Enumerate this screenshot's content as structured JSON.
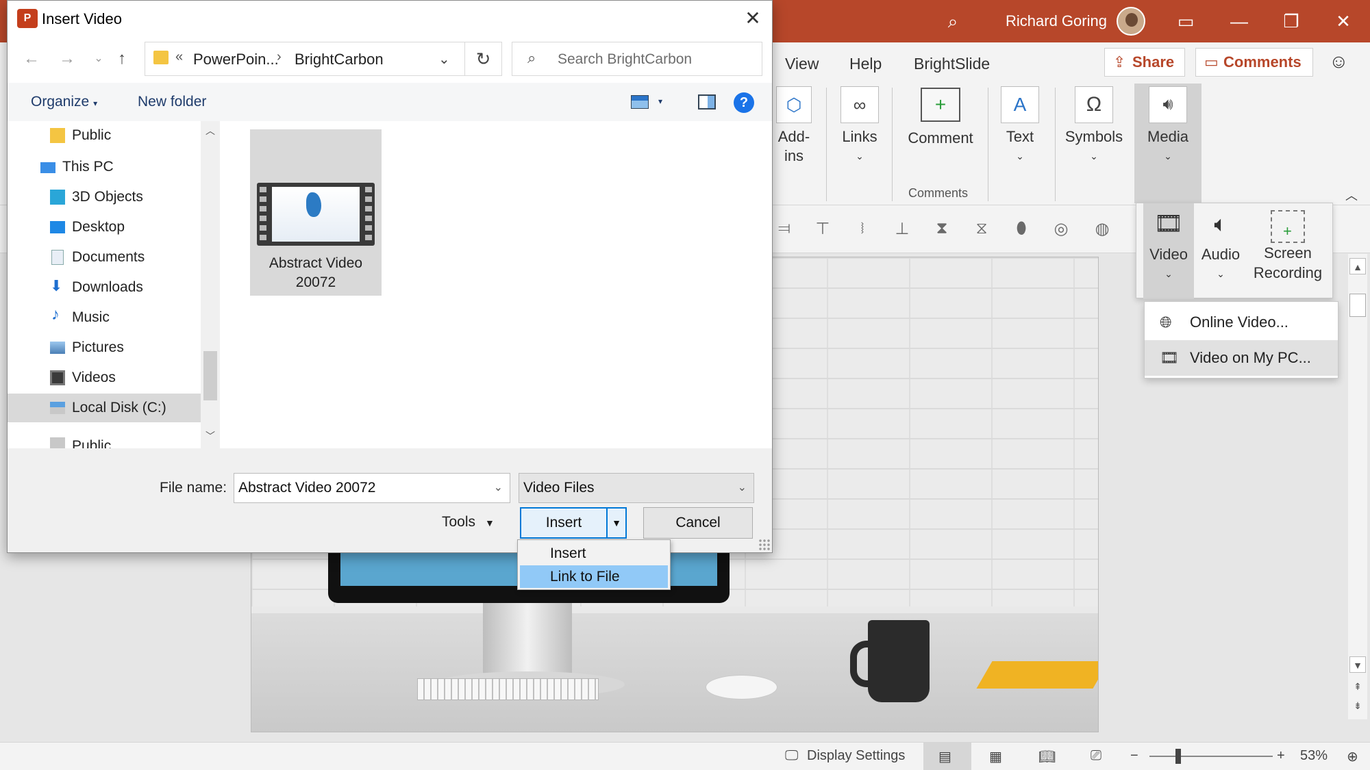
{
  "ppt": {
    "user_name": "Richard Goring",
    "tabs": [
      "View",
      "Help",
      "BrightSlide"
    ],
    "share_label": "Share",
    "comments_label": "Comments",
    "ribbon": {
      "addins_label": "Add-",
      "addins_label2": "ins",
      "links_label": "Links",
      "comment_label": "Comment",
      "text_label": "Text",
      "symbols_label": "Symbols",
      "media_label": "Media",
      "comments_group_label": "Comments"
    },
    "media_panel": {
      "video_label": "Video",
      "audio_label": "Audio",
      "screen_recording_label1": "Screen",
      "screen_recording_label2": "Recording"
    },
    "video_menu": {
      "online_video": "Online Video...",
      "video_on_pc": "Video on My PC..."
    },
    "status": {
      "display_settings": "Display Settings",
      "zoom": "53%"
    }
  },
  "dialog": {
    "title": "Insert Video",
    "breadcrumb": [
      "PowerPoin...",
      "BrightCarbon"
    ],
    "search_placeholder": "Search BrightCarbon",
    "organize_label": "Organize",
    "new_folder_label": "New folder",
    "nav_items": [
      {
        "label": "Public"
      },
      {
        "label": "This PC"
      },
      {
        "label": "3D Objects"
      },
      {
        "label": "Desktop"
      },
      {
        "label": "Documents"
      },
      {
        "label": "Downloads"
      },
      {
        "label": "Music"
      },
      {
        "label": "Pictures"
      },
      {
        "label": "Videos"
      },
      {
        "label": "Local Disk (C:)"
      },
      {
        "label": "Public (\\\\SYNOLOGY"
      }
    ],
    "file": {
      "name_line1": "Abstract Video",
      "name_line2": "20072"
    },
    "file_name_label": "File name:",
    "file_name_value": "Abstract Video 20072",
    "file_type_value": "Video Files",
    "tools_label": "Tools",
    "insert_label": "Insert",
    "cancel_label": "Cancel",
    "insert_menu": [
      "Insert",
      "Link to File"
    ]
  }
}
